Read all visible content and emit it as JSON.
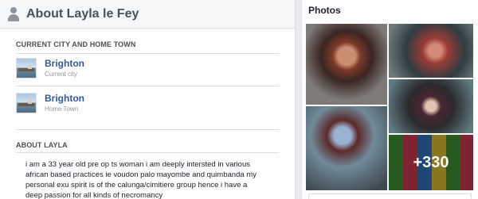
{
  "about": {
    "title": "About Layla le Fey",
    "section_city_title": "CURRENT CITY AND HOME TOWN",
    "places": [
      {
        "name": "Brighton",
        "type": "Current city"
      },
      {
        "name": "Brighton",
        "type": "Home Town"
      }
    ],
    "section_about_title": "ABOUT LAYLA",
    "about_lines": [
      "i am a 33 year old pre op ts woman i am deeply intersted in various",
      "african based practices ie voudon palo mayombe and quimbanda my",
      "personal exu spirit is of the calunga/cimitiere group hence i have a",
      "deep passion for all kinds of necromancy"
    ]
  },
  "photos": {
    "title": "Photos",
    "more_count": "+330"
  },
  "colors": {
    "link": "#365899",
    "secondary_text": "#90949c",
    "page_bg": "#e9ebee"
  }
}
